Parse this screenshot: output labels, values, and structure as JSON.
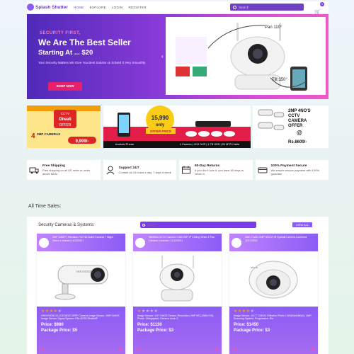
{
  "nav": {
    "brand": "Splash Shutter",
    "links": [
      "HOME",
      "EXPLORE",
      "LOGIN",
      "REGISTER"
    ],
    "search_placeholder": "Search",
    "cart_count": "0"
  },
  "hero": {
    "kicker": "SECURITY FIRST,",
    "title": "We Are The Best Seller",
    "subtitle": "Starting At ... $20",
    "description": "Your Security Matters We Give You Best Solution & Solved It Very Smoothly.",
    "cta": "SHOP NOW",
    "image_texts": [
      "Pan 110°",
      "Tilt 350°"
    ]
  },
  "promos": {
    "p1": {
      "lines": [
        "CCTV",
        "Diwali",
        "OFFER",
        "4",
        "2MP CAMERAS",
        "9,999/-"
      ]
    },
    "p2": {
      "lines": [
        "15,990",
        "only",
        "OFFER PRICE",
        "Android Phone",
        "4 Camera | 4CH DVR | 1 TB HDD | 50 MTR Cable"
      ]
    },
    "p3": {
      "lines": [
        "2MP 4NO'S",
        "CCTV",
        "CAMERA",
        "OFFER",
        "@",
        "Rs.6600/-"
      ]
    }
  },
  "features": [
    {
      "title": "Free Shipping",
      "desc": "Free shipping on all US order or order above $200",
      "icon": "truck-icon"
    },
    {
      "title": "Support 24/7",
      "desc": "Contact us 24 hours a day, 7 days a week",
      "icon": "support-icon"
    },
    {
      "title": "60-Day Returns",
      "desc": "If you don't love it, you have 60 days to return it.",
      "icon": "calendar-icon"
    },
    {
      "title": "100% Payment Secure",
      "desc": "We ensure secure payment with 100% gurantee",
      "icon": "payment-icon"
    }
  ],
  "section": {
    "title": "All Time Sales:",
    "panel_title": "Security Cameras & Systems:",
    "search_placeholder": "Search",
    "view_all": "VIEW ALL"
  },
  "products": [
    {
      "head": "2MP 1080P ( Hikvision Full HD Bullet Camera + Night Vision Lumimed 11/12/2021",
      "description": "HIKVISION DS-2CE16D0T-IRPF Camera Image Sensor: 2MP CMOS Image Sensor Signal System: PAL/NTSC/Bullet/IP",
      "price": "Price: $980",
      "package": "Package Price: $5",
      "rating": 4
    },
    {
      "head": "Wireless CCTV Camera V380 WiFi IP Ceiling White & Pan Camera Lumimed: 11/12/2021",
      "description": "Image Sensor: 1/3\" CMOS Sensor, Resolution 2MP HD (1080x720), Pixels: 1Megapixel, Camera Lens: 3",
      "price": "Price: $1130",
      "package": "Package Price: $3",
      "rating": 1
    },
    {
      "head": "2MC-T1A21 2MP HDCVI IR Eyeball Camera Lumimed: 11/12/2021",
      "description": "Image Sensor: 1/2.7\" CMOS, Effective Pixels 1920(H)x1080(V), 2MP, Scanning System: Progressive, Ele",
      "price": "Price: $1450",
      "package": "Package Price: $3",
      "rating": 4
    }
  ],
  "colors": {
    "accent": "#7c3aed",
    "cta": "#e6206a",
    "card": "#8b5cf6"
  }
}
